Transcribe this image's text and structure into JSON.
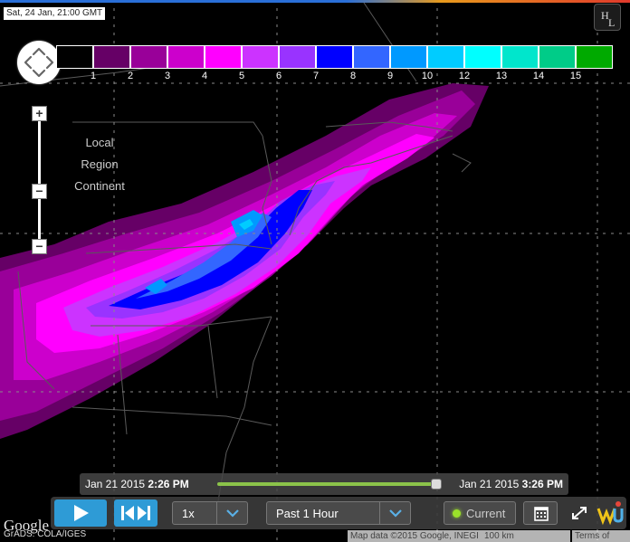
{
  "header": {
    "timestamp": "Sat, 24 Jan, 21:00 GMT",
    "hl_h": "H",
    "hl_l": "L"
  },
  "legend": {
    "colors": [
      "#000000",
      "#660066",
      "#990099",
      "#cc00cc",
      "#ff00ff",
      "#cc33ff",
      "#9933ff",
      "#0000ff",
      "#3366ff",
      "#0099ff",
      "#00ccff",
      "#00ffff",
      "#00e6cc",
      "#00cc88",
      "#00aa00"
    ],
    "labels": [
      "1",
      "2",
      "3",
      "4",
      "5",
      "6",
      "7",
      "8",
      "9",
      "10",
      "12",
      "13",
      "14",
      "15"
    ]
  },
  "zoom": {
    "plus": "+",
    "minus1": "−",
    "minus2": "−",
    "levels": [
      "Local",
      "Region",
      "Continent"
    ]
  },
  "timeline": {
    "start_date": "Jan 21 2015",
    "start_time": "2:26 PM",
    "end_date": "Jan 21 2015",
    "end_time": "3:26 PM"
  },
  "controls": {
    "speed": "1x",
    "range": "Past 1 Hour",
    "current_label": "Current"
  },
  "footer": {
    "google": "Google",
    "credit": "GrADS: COLA/IGES",
    "map_data": "Map data ©2015 Google, INEGI",
    "scale": "100 km",
    "terms": "Terms of Use"
  },
  "icons": {
    "pan": "pan-arrows-icon",
    "play": "play-icon",
    "step": "step-icon",
    "calendar": "calendar-icon",
    "expand": "expand-icon",
    "logo": "wu-logo-icon"
  }
}
